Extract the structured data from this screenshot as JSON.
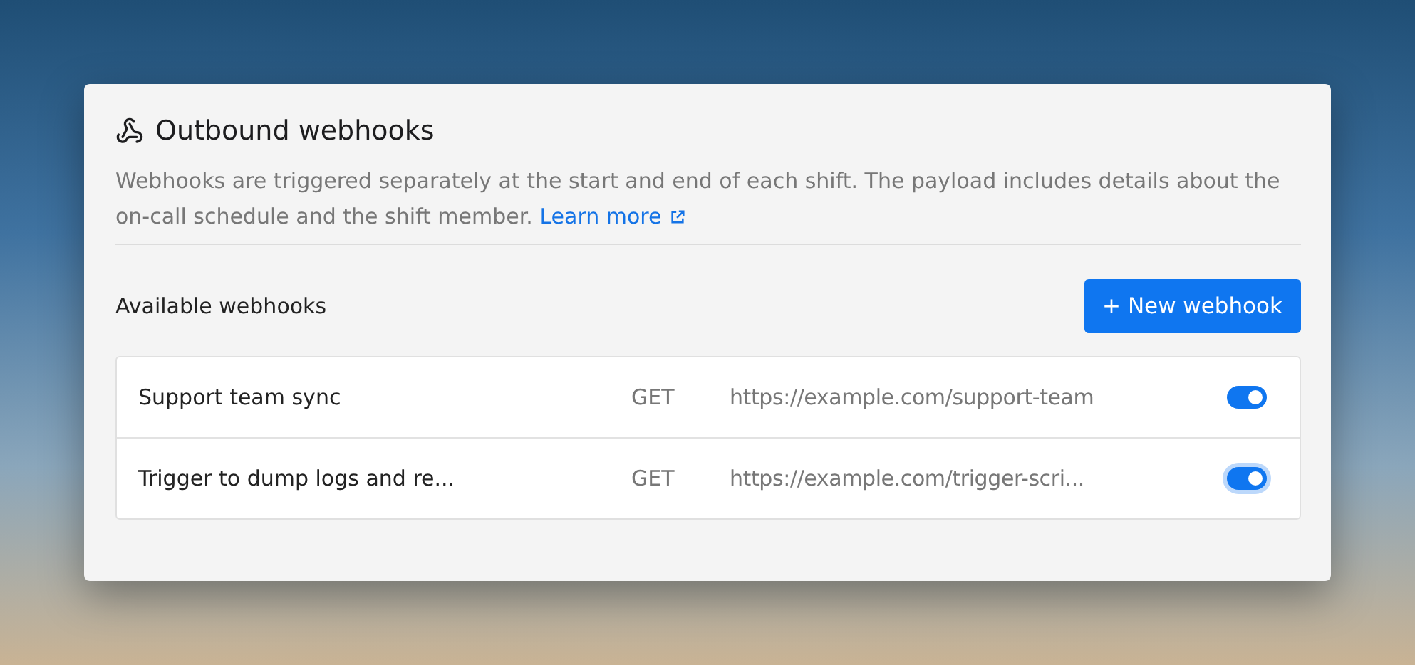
{
  "panel": {
    "title": "Outbound webhooks",
    "description": "Webhooks are triggered separately at the start and end of each shift. The payload includes details about the on-call schedule and the shift member.",
    "link": "Learn more"
  },
  "section": {
    "title": "Available webhooks",
    "button": "+ New webhook"
  },
  "webhooks": [
    {
      "name": "Support team sync",
      "method": "GET",
      "url": "https://example.com/support-team",
      "on": true,
      "focused": false
    },
    {
      "name": "Trigger to dump logs and re...",
      "method": "GET",
      "url": "https://example.com/trigger-scri...",
      "on": true,
      "focused": true
    }
  ]
}
